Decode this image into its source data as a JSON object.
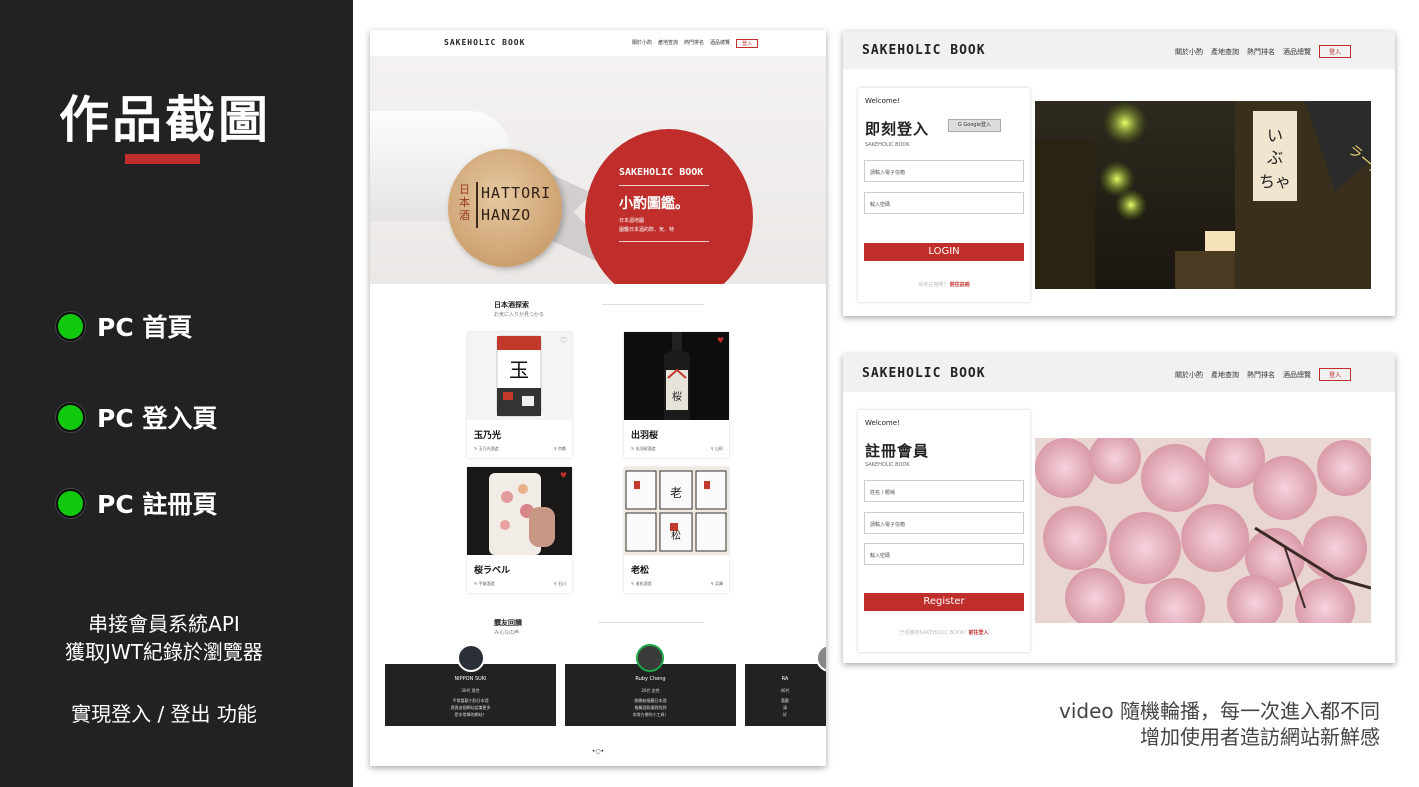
{
  "left": {
    "title": "作品截圖",
    "features": [
      "PC 首頁",
      "PC 登入頁",
      "PC 註冊頁"
    ],
    "note1": [
      "串接會員系統API",
      "獲取JWT紀錄於瀏覽器"
    ],
    "note2": "實現登入 / 登出 功能",
    "accent": "#bf2e2a",
    "dot_color": "#12c80f"
  },
  "home": {
    "brand": "SAKEHOLIC BOOK",
    "nav_links": [
      "關於小酌",
      "產地查詢",
      "熱門排名",
      "酒品總覽"
    ],
    "nav_login": "登入",
    "cork_jp": "日本酒",
    "cork_en": [
      "HATTORI",
      "HANZO"
    ],
    "hero_brand": "SAKEHOLIC BOOK",
    "hero_title": "小酌圖鑑。",
    "hero_sub": [
      "日本酒地圖",
      "圖鑑日本酒的酢、気、特"
    ],
    "explore_title": "日本酒探索",
    "explore_sub": "お気に入りが見つかる",
    "sakes": [
      {
        "name": "玉乃光",
        "meta": "玉乃光酒造",
        "loc": "京都",
        "heart": "♡"
      },
      {
        "name": "出羽桜",
        "meta": "出羽桜酒造",
        "loc": "山形",
        "heart": "♥"
      },
      {
        "name": "桜ラベル",
        "meta": "手取酒造",
        "loc": "石川",
        "heart": "♥"
      },
      {
        "name": "老松",
        "meta": "老松酒造",
        "loc": "兵庫",
        "heart": ""
      }
    ],
    "reviews_title": "饌友回饋",
    "reviews_sub": "みんなの声",
    "reviews": [
      {
        "name": "NIPPON SUKI",
        "lines": [
          "30代 男性",
          "平常喜歡小酌日本酒",
          "透過這個網站認識更多",
          "是非常棒的網站！"
        ]
      },
      {
        "name": "Ruby Cheng",
        "lines": [
          "20代 女性",
          "剛開始接觸日本酒",
          "推薦酒款讓我找到",
          "非常方便的小工具！"
        ]
      },
      {
        "name": "RA",
        "lines": [
          "40代",
          "喜歡",
          "清",
          "好"
        ]
      }
    ],
    "pager": "•○•"
  },
  "login": {
    "brand": "SAKEHOLIC BOOK",
    "nav_links": [
      "關於小酌",
      "產地查詢",
      "熱門排名",
      "酒品總覽"
    ],
    "nav_login": "登入",
    "welcome": "Welcome!",
    "title": "即刻登入",
    "google": "Google登入",
    "sub": "SAKEHOLIC BOOK",
    "email_placeholder": "請輸入電子信箱",
    "password_placeholder": "輸入密碼",
    "button": "LOGIN",
    "foot_text": "尚未註冊嗎？",
    "foot_link": "前往註冊"
  },
  "register": {
    "brand": "SAKEHOLIC BOOK",
    "nav_links": [
      "關於小酌",
      "產地查詢",
      "熱門排名",
      "酒品總覽"
    ],
    "nav_login": "登入",
    "welcome": "Welcome!",
    "title": "註冊會員",
    "sub": "SAKEHOLIC BOOK",
    "name_placeholder": "姓名 / 暱稱",
    "email_placeholder": "請輸入電子信箱",
    "password_placeholder": "輸入密碼",
    "button": "Register",
    "foot_text": "已經擁有SAKEHOLIC BOOK?",
    "foot_link": "前往登入"
  },
  "caption": [
    "video 隨機輪播，每一次進入都不同",
    "增加使用者造訪網站新鮮感"
  ]
}
